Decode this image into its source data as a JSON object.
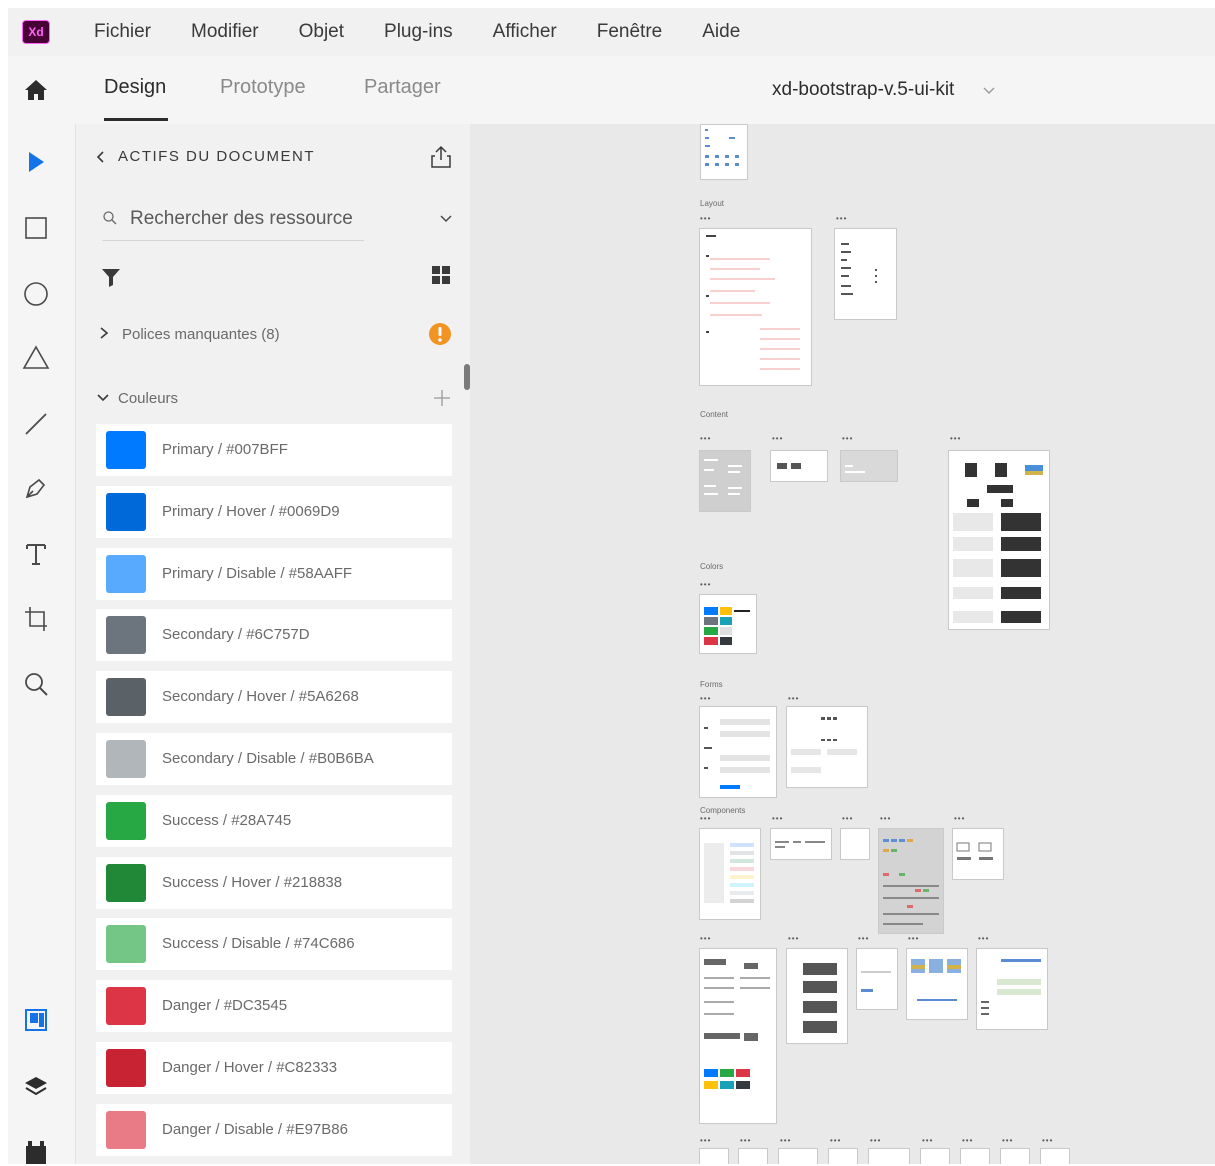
{
  "app": {
    "logo_text": "Xd"
  },
  "menu": [
    "Fichier",
    "Modifier",
    "Objet",
    "Plug-ins",
    "Afficher",
    "Fenêtre",
    "Aide"
  ],
  "tabs": [
    "Design",
    "Prototype",
    "Partager"
  ],
  "active_tab": "Design",
  "document": {
    "title": "xd-bootstrap-v.5-ui-kit"
  },
  "tools": [
    "select-icon",
    "rectangle-icon",
    "ellipse-icon",
    "polygon-icon",
    "line-icon",
    "pen-icon",
    "text-icon",
    "artboard-icon",
    "zoom-icon",
    "assets-icon",
    "layers-icon",
    "plugins-icon"
  ],
  "assets_panel": {
    "header": "ACTIFS DU DOCUMENT",
    "search_placeholder": "Rechercher des ressource",
    "missing_fonts": "Polices manquantes (8)",
    "colors_label": "Couleurs",
    "colors": [
      {
        "label": "Primary / #007BFF",
        "hex": "#007BFF"
      },
      {
        "label": "Primary / Hover / #0069D9",
        "hex": "#0069D9"
      },
      {
        "label": "Primary / Disable / #58AAFF",
        "hex": "#58AAFF"
      },
      {
        "label": "Secondary / #6C757D",
        "hex": "#6C757D"
      },
      {
        "label": "Secondary / Hover / #5A6268",
        "hex": "#5A6268"
      },
      {
        "label": "Secondary / Disable / #B0B6BA",
        "hex": "#B0B6BA"
      },
      {
        "label": "Success / #28A745",
        "hex": "#28A745"
      },
      {
        "label": "Success / Hover / #218838",
        "hex": "#218838"
      },
      {
        "label": "Success / Disable / #74C686",
        "hex": "#74C686"
      },
      {
        "label": "Danger / #DC3545",
        "hex": "#DC3545"
      },
      {
        "label": "Danger / Hover / #C82333",
        "hex": "#C82333"
      },
      {
        "label": "Danger / Disable / #E97B86",
        "hex": "#E97B86"
      }
    ]
  },
  "canvas": {
    "sections": [
      "Layout",
      "Content",
      "Colors",
      "Forms",
      "Components"
    ],
    "artboard_dots": "•••"
  },
  "colors": {
    "warning": "#F29423",
    "accent": "#1473E6",
    "logo_bg": "#470137",
    "logo_fg": "#FF61F6"
  }
}
